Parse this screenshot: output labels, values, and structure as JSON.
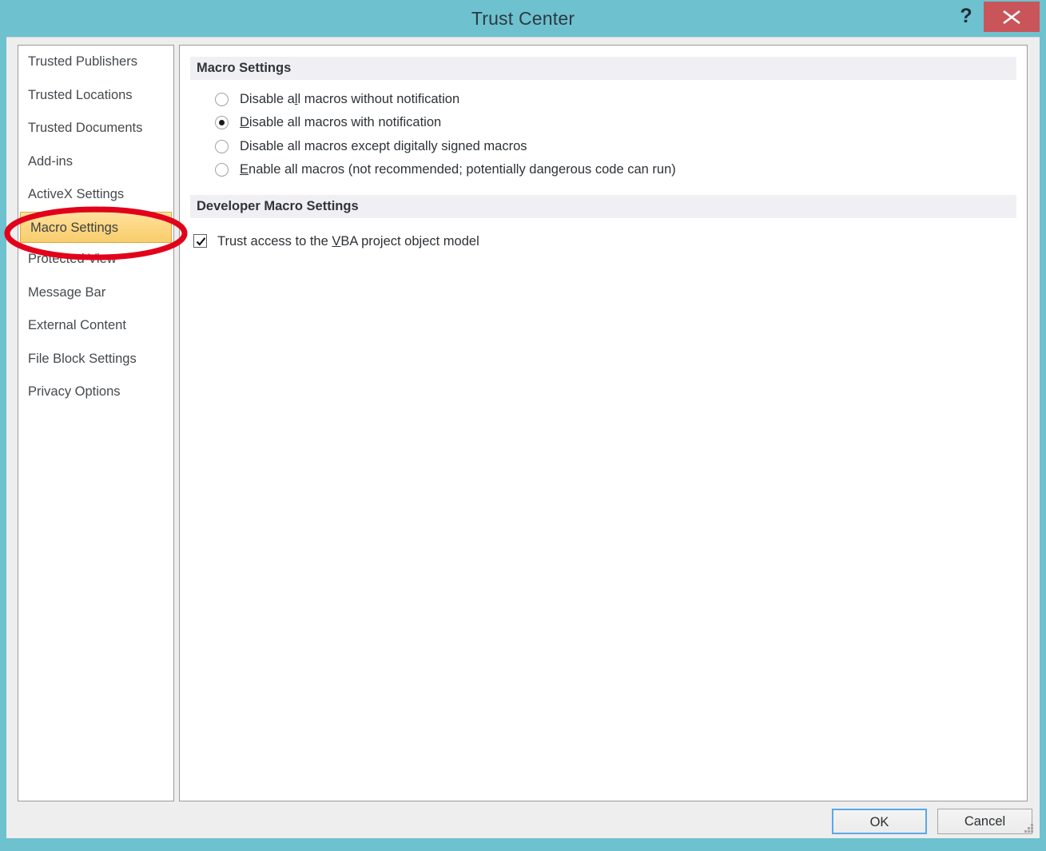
{
  "window": {
    "title": "Trust Center",
    "help_icon": "question-mark-icon",
    "close_icon": "close-x-icon",
    "titlebar_color": "#6ec1ce",
    "close_button_color": "#c9555b"
  },
  "sidebar": {
    "items": [
      {
        "label": "Trusted Publishers",
        "selected": false
      },
      {
        "label": "Trusted Locations",
        "selected": false
      },
      {
        "label": "Trusted Documents",
        "selected": false
      },
      {
        "label": "Add-ins",
        "selected": false
      },
      {
        "label": "ActiveX Settings",
        "selected": false
      },
      {
        "label": "Macro Settings",
        "selected": true
      },
      {
        "label": "Protected View",
        "selected": false
      },
      {
        "label": "Message Bar",
        "selected": false
      },
      {
        "label": "External Content",
        "selected": false
      },
      {
        "label": "File Block Settings",
        "selected": false
      },
      {
        "label": "Privacy Options",
        "selected": false
      }
    ],
    "selected_highlight_color": "#fdd783"
  },
  "main": {
    "macro_settings": {
      "header": "Macro Settings",
      "options": [
        {
          "pre": "Disable a",
          "accel": "l",
          "post": "l macros without notification",
          "checked": false
        },
        {
          "pre": "",
          "accel": "D",
          "post": "isable all macros with notification",
          "checked": true
        },
        {
          "pre": "Disable all macros except di",
          "accel": "g",
          "post": "itally signed macros",
          "checked": false
        },
        {
          "pre": "",
          "accel": "E",
          "post": "nable all macros (not recommended; potentially dangerous code can run)",
          "checked": false
        }
      ]
    },
    "developer_macro_settings": {
      "header": "Developer Macro Settings",
      "checkbox": {
        "pre": "Trust access to the ",
        "accel": "V",
        "post": "BA project object model",
        "checked": true
      }
    }
  },
  "footer": {
    "ok_label": "OK",
    "cancel_label": "Cancel",
    "resize_grip": "resize-grip-icon"
  },
  "annotation": {
    "shape": "ellipse",
    "color": "#e2001a",
    "target": "Macro Settings"
  }
}
